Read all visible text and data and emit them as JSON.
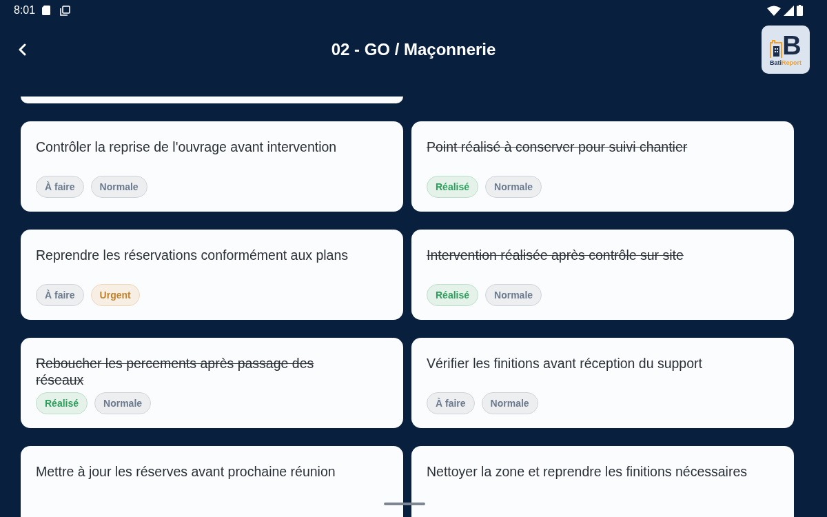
{
  "status_bar": {
    "time": "8:01"
  },
  "header": {
    "title": "02 - GO / Maçonnerie",
    "logo": {
      "monogram": "B",
      "wordmark": [
        "Bati",
        "Report"
      ]
    }
  },
  "cards": [
    {
      "title": "Contrôler la reprise de l'ouvrage avant intervention",
      "done": false,
      "chips": [
        {
          "label": "À faire",
          "color": "#6b7a8c"
        },
        {
          "label": "Normale",
          "color": "#6b7a8c"
        }
      ]
    },
    {
      "title": "Point réalisé à conserver pour suivi chantier",
      "done": true,
      "chips": [
        {
          "label": "Réalisé",
          "color": "#2e9e5b"
        },
        {
          "label": "Normale",
          "color": "#6b7a8c"
        }
      ]
    },
    {
      "title": "Reprendre les réservations conformément aux plans",
      "done": false,
      "chips": [
        {
          "label": "À faire",
          "color": "#6b7a8c"
        },
        {
          "label": "Urgent",
          "color": "#c4832a"
        }
      ]
    },
    {
      "title": "Intervention réalisée après contrôle sur site",
      "done": true,
      "chips": [
        {
          "label": "Réalisé",
          "color": "#2e9e5b"
        },
        {
          "label": "Normale",
          "color": "#6b7a8c"
        }
      ]
    },
    {
      "title": "Reboucher les percements après passage des réseaux",
      "done": true,
      "chips": [
        {
          "label": "Réalisé",
          "color": "#2e9e5b"
        },
        {
          "label": "Normale",
          "color": "#6b7a8c"
        }
      ]
    },
    {
      "title": "Vérifier les finitions avant réception du support",
      "done": false,
      "chips": [
        {
          "label": "À faire",
          "color": "#6b7a8c"
        },
        {
          "label": "Normale",
          "color": "#6b7a8c"
        }
      ]
    },
    {
      "title": "Mettre à jour les réserves avant prochaine réunion",
      "done": false
    },
    {
      "title": "Nettoyer la zone et reprendre les finitions nécessaires",
      "done": false
    }
  ]
}
